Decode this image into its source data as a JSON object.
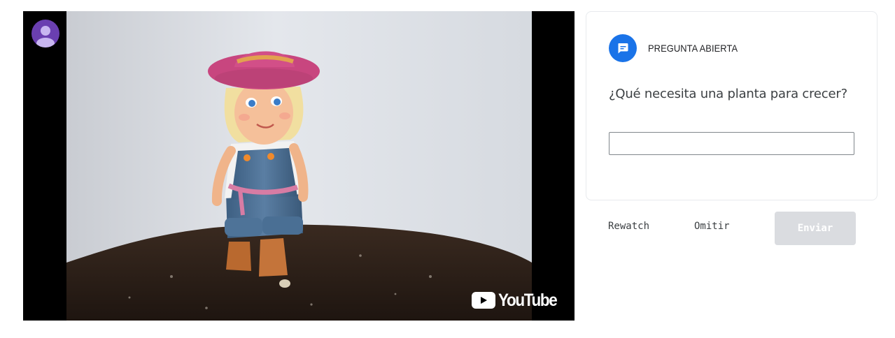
{
  "video": {
    "logo_text": "YouTube",
    "avatar_icon": "user-avatar-icon",
    "play_icon": "play-icon"
  },
  "question": {
    "type_label": "PREGUNTA ABIERTA",
    "type_icon": "comment-icon",
    "text": "¿Qué necesita una planta para crecer?",
    "answer_value": "",
    "answer_placeholder": ""
  },
  "actions": {
    "rewatch_label": "Rewatch",
    "skip_label": "Omitir",
    "submit_label": "Enviar"
  },
  "colors": {
    "accent": "#1a73e8",
    "avatar_bg": "#6a3fb0",
    "submit_disabled_bg": "#dadce0"
  }
}
